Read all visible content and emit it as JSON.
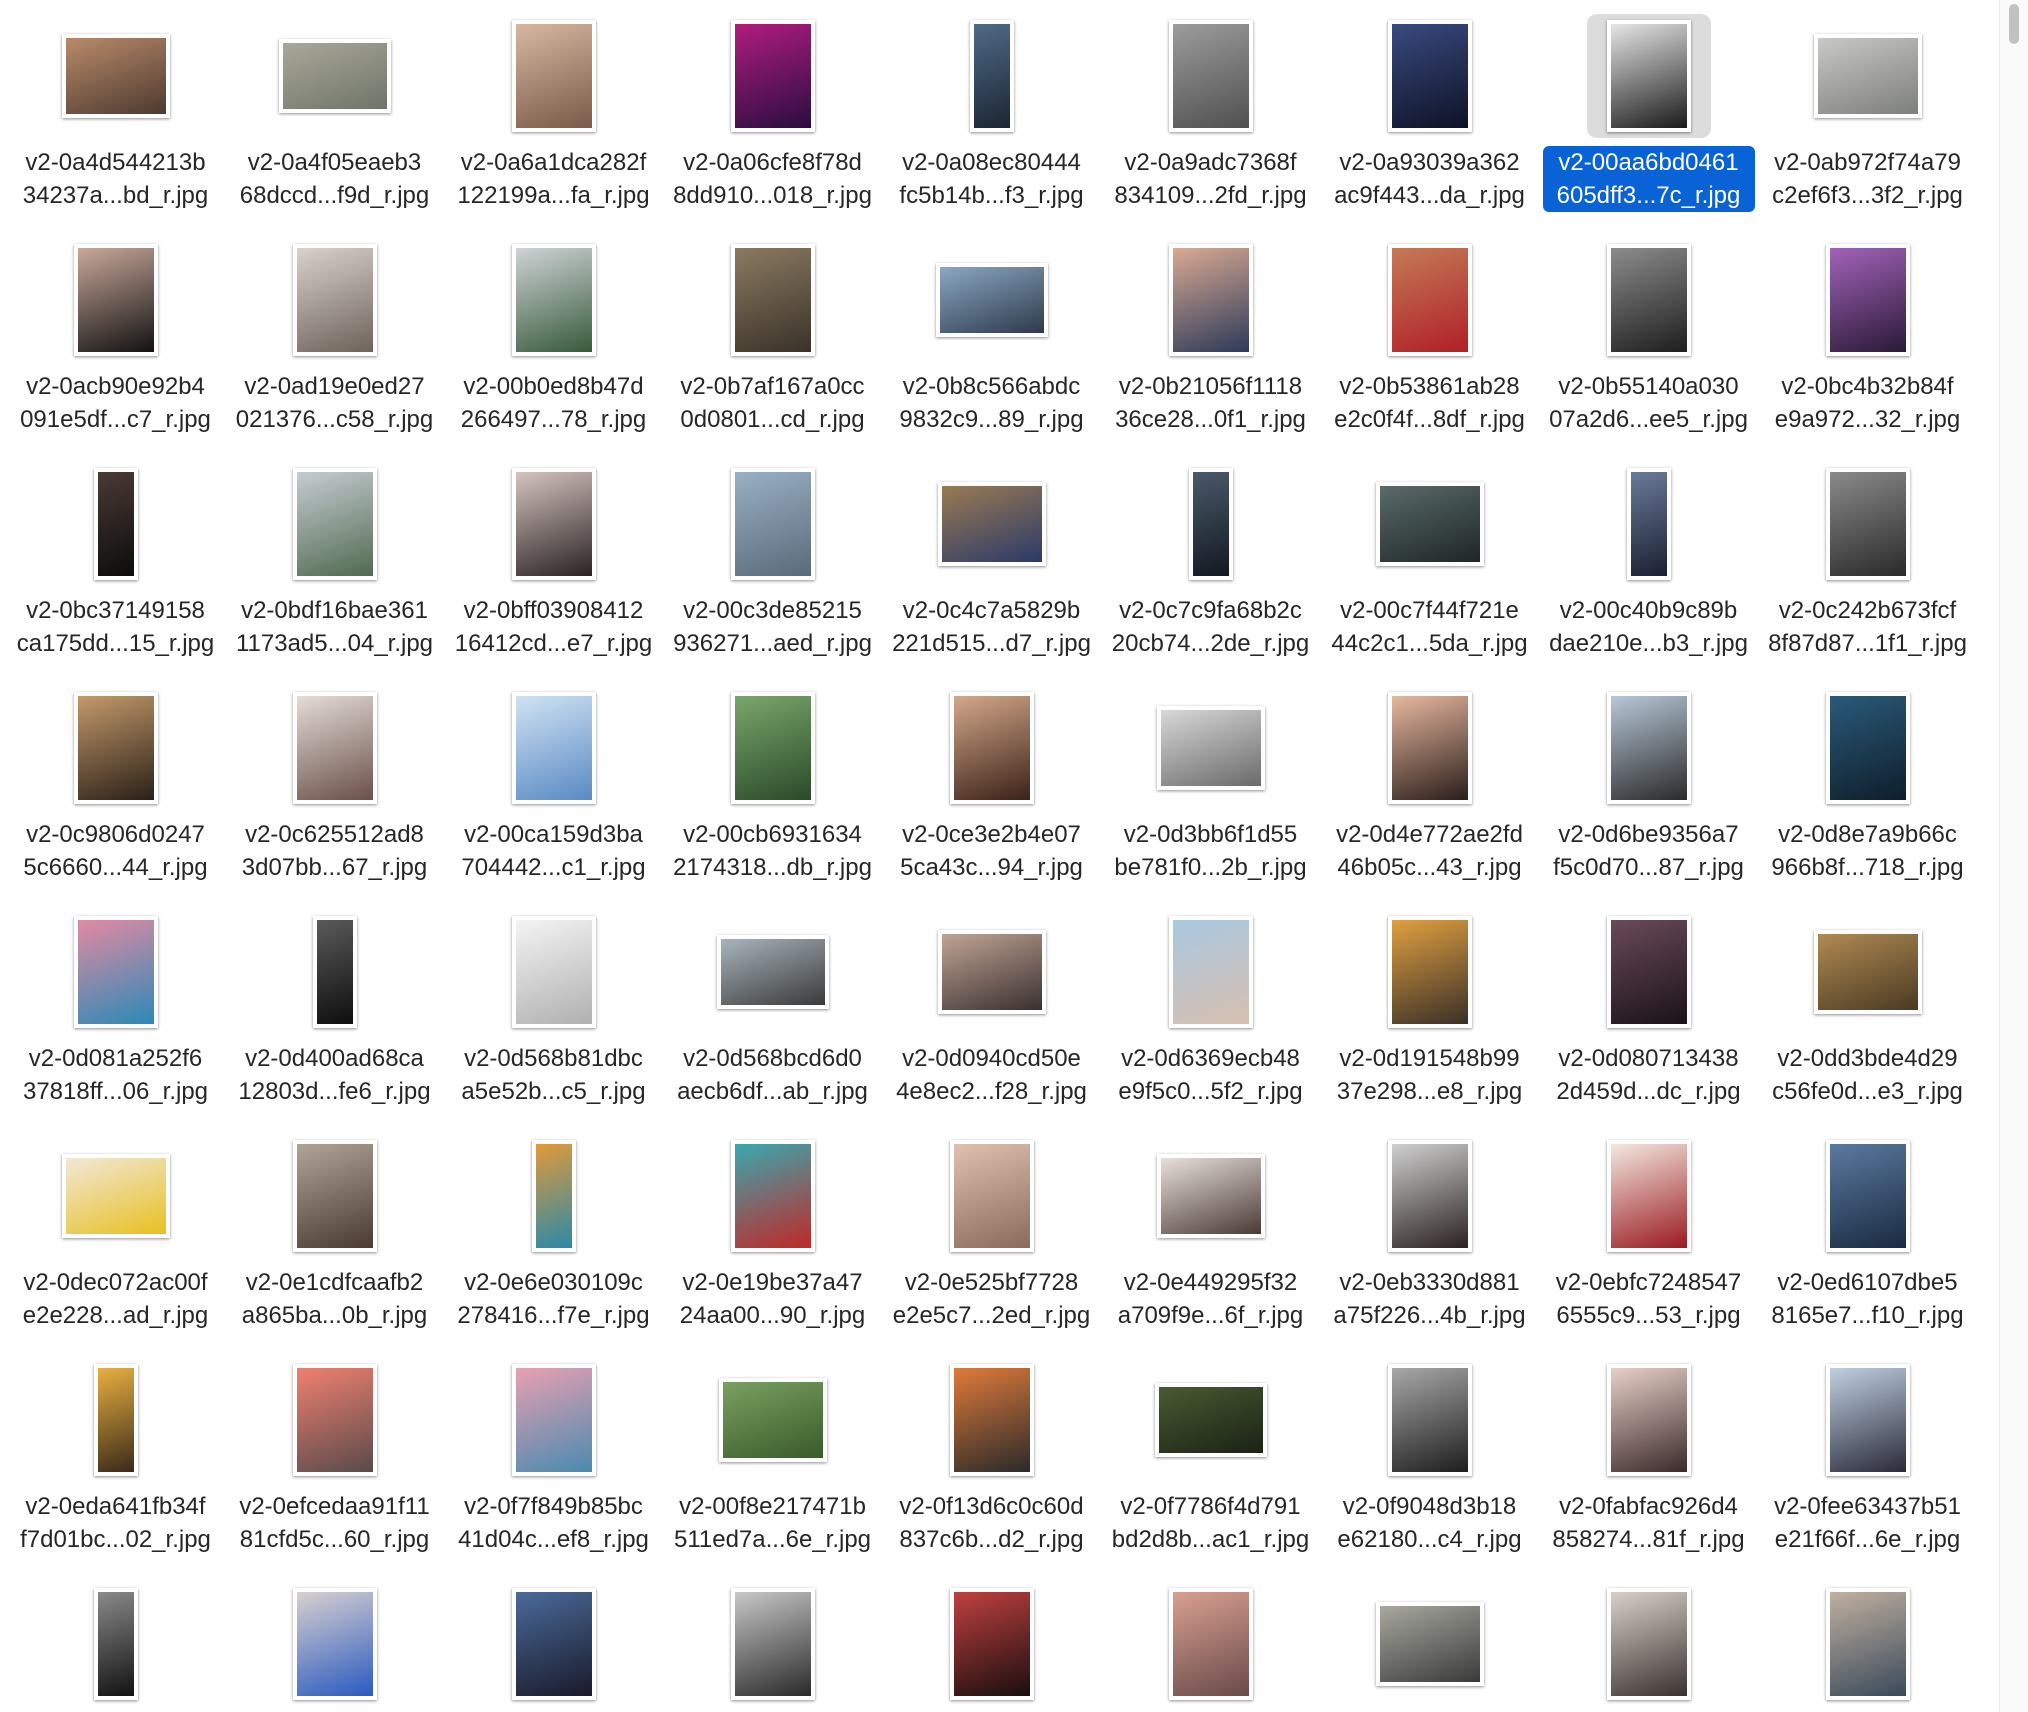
{
  "colors": {
    "selection_fill": "#0a63d6",
    "selection_thumb_bg": "#dcdcdc",
    "label_text": "#262626"
  },
  "files": [
    {
      "line1": "v2-0a4d544213b",
      "line2": "34237a...bd_r.jpg",
      "orientation": "landscape",
      "tone": [
        "#b98a6a",
        "#4d3a30"
      ],
      "selected": false
    },
    {
      "line1": "v2-0a4f05eaeb3",
      "line2": "68dccd...f9d_r.jpg",
      "orientation": "wide",
      "tone": [
        "#a9a89a",
        "#6f7468"
      ],
      "selected": false
    },
    {
      "line1": "v2-0a6a1dca282f",
      "line2": "122199a...fa_r.jpg",
      "orientation": "portrait",
      "tone": [
        "#d6b8a2",
        "#7a5a48"
      ],
      "selected": false
    },
    {
      "line1": "v2-0a06cfe8f78d",
      "line2": "8dd910...018_r.jpg",
      "orientation": "portrait",
      "tone": [
        "#b01c80",
        "#2a0d40"
      ],
      "selected": false
    },
    {
      "line1": "v2-0a08ec80444",
      "line2": "fc5b14b...f3_r.jpg",
      "orientation": "tall",
      "tone": [
        "#4f6a86",
        "#1c2633"
      ],
      "selected": false
    },
    {
      "line1": "v2-0a9adc7368f",
      "line2": "834109...2fd_r.jpg",
      "orientation": "portrait",
      "tone": [
        "#9c9c9c",
        "#505050"
      ],
      "selected": false
    },
    {
      "line1": "v2-0a93039a362",
      "line2": "ac9f443...da_r.jpg",
      "orientation": "portrait",
      "tone": [
        "#3a4a80",
        "#0e1226"
      ],
      "selected": false
    },
    {
      "line1": "v2-00aa6bd0461",
      "line2": "605dff3...7c_r.jpg",
      "orientation": "portrait",
      "tone": [
        "#e6e6e6",
        "#1a1a1a"
      ],
      "selected": true
    },
    {
      "line1": "v2-0ab972f74a79",
      "line2": "c2ef6f3...3f2_r.jpg",
      "orientation": "landscape",
      "tone": [
        "#c8c8c4",
        "#7d7f7a"
      ],
      "selected": false
    },
    {
      "line1": "v2-0acb90e92b4",
      "line2": "091e5df...c7_r.jpg",
      "orientation": "portrait",
      "tone": [
        "#c9a89a",
        "#121212"
      ],
      "selected": false
    },
    {
      "line1": "v2-0ad19e0ed27",
      "line2": "021376...c58_r.jpg",
      "orientation": "portrait",
      "tone": [
        "#d8d2cc",
        "#6e625a"
      ],
      "selected": false
    },
    {
      "line1": "v2-00b0ed8b47d",
      "line2": "266497...78_r.jpg",
      "orientation": "portrait",
      "tone": [
        "#cfd3d6",
        "#375a3a"
      ],
      "selected": false
    },
    {
      "line1": "v2-0b7af167a0cc",
      "line2": "0d0801...cd_r.jpg",
      "orientation": "portrait",
      "tone": [
        "#8a7a62",
        "#3a3228"
      ],
      "selected": false
    },
    {
      "line1": "v2-0b8c566abdc",
      "line2": "9832c9...89_r.jpg",
      "orientation": "wide",
      "tone": [
        "#8aa7c4",
        "#2e3a4a"
      ],
      "selected": false
    },
    {
      "line1": "v2-0b21056f1118",
      "line2": "36ce28...0f1_r.jpg",
      "orientation": "portrait",
      "tone": [
        "#d9aa92",
        "#2c3a5a"
      ],
      "selected": false
    },
    {
      "line1": "v2-0b53861ab28",
      "line2": "e2c0f4f...8df_r.jpg",
      "orientation": "portrait",
      "tone": [
        "#c47a56",
        "#b01f28"
      ],
      "selected": false
    },
    {
      "line1": "v2-0b55140a030",
      "line2": "07a2d6...ee5_r.jpg",
      "orientation": "portrait",
      "tone": [
        "#8c8c8c",
        "#1e1e1e"
      ],
      "selected": false
    },
    {
      "line1": "v2-0bc4b32b84f",
      "line2": "e9a972...32_r.jpg",
      "orientation": "portrait",
      "tone": [
        "#a262b8",
        "#2a1a38"
      ],
      "selected": false
    },
    {
      "line1": "v2-0bc37149158",
      "line2": "ca175dd...15_r.jpg",
      "orientation": "tall",
      "tone": [
        "#4a3a34",
        "#0c0c0c"
      ],
      "selected": false
    },
    {
      "line1": "v2-0bdf16bae361",
      "line2": "1173ad5...04_r.jpg",
      "orientation": "portrait",
      "tone": [
        "#c6ccd2",
        "#506a50"
      ],
      "selected": false
    },
    {
      "line1": "v2-0bff03908412",
      "line2": "16412cd...e7_r.jpg",
      "orientation": "portrait",
      "tone": [
        "#d4c4c0",
        "#2a2222"
      ],
      "selected": false
    },
    {
      "line1": "v2-00c3de85215",
      "line2": "936271...aed_r.jpg",
      "orientation": "portrait",
      "tone": [
        "#9ab0c4",
        "#5a6a7a"
      ],
      "selected": false
    },
    {
      "line1": "v2-0c4c7a5829b",
      "line2": "221d515...d7_r.jpg",
      "orientation": "landscape",
      "tone": [
        "#9a7a52",
        "#2a3a6a"
      ],
      "selected": false
    },
    {
      "line1": "v2-0c7c9fa68b2c",
      "line2": "20cb74...2de_r.jpg",
      "orientation": "tall",
      "tone": [
        "#4a5a6a",
        "#121820"
      ],
      "selected": false
    },
    {
      "line1": "v2-00c7f44f721e",
      "line2": "44c2c1...5da_r.jpg",
      "orientation": "landscape",
      "tone": [
        "#5a6a6a",
        "#1e2626"
      ],
      "selected": false
    },
    {
      "line1": "v2-00c40b9c89b",
      "line2": "dae210e...b3_r.jpg",
      "orientation": "tall",
      "tone": [
        "#6a7a9a",
        "#1a2030"
      ],
      "selected": false
    },
    {
      "line1": "v2-0c242b673fcf",
      "line2": "8f87d87...1f1_r.jpg",
      "orientation": "portrait",
      "tone": [
        "#8a8a8a",
        "#2a2a2a"
      ],
      "selected": false
    },
    {
      "line1": "v2-0c9806d0247",
      "line2": "5c6660...44_r.jpg",
      "orientation": "portrait",
      "tone": [
        "#c49a6a",
        "#2a2018"
      ],
      "selected": false
    },
    {
      "line1": "v2-0c625512ad8",
      "line2": "3d07bb...67_r.jpg",
      "orientation": "portrait",
      "tone": [
        "#e4dcd8",
        "#6a5048"
      ],
      "selected": false
    },
    {
      "line1": "v2-00ca159d3ba",
      "line2": "704442...c1_r.jpg",
      "orientation": "portrait",
      "tone": [
        "#cfe2f3",
        "#5a8ac4"
      ],
      "selected": false
    },
    {
      "line1": "v2-00cb6931634",
      "line2": "2174318...db_r.jpg",
      "orientation": "portrait",
      "tone": [
        "#7aa66a",
        "#2a4a2a"
      ],
      "selected": false
    },
    {
      "line1": "v2-0ce3e2b4e07",
      "line2": "5ca43c...94_r.jpg",
      "orientation": "portrait",
      "tone": [
        "#d4a88a",
        "#3a2218"
      ],
      "selected": false
    },
    {
      "line1": "v2-0d3bb6f1d55",
      "line2": "be781f0...2b_r.jpg",
      "orientation": "landscape",
      "tone": [
        "#d8d8d8",
        "#6a6a6a"
      ],
      "selected": false
    },
    {
      "line1": "v2-0d4e772ae2fd",
      "line2": "46b05c...43_r.jpg",
      "orientation": "portrait",
      "tone": [
        "#e8b8a0",
        "#2a1e1a"
      ],
      "selected": false
    },
    {
      "line1": "v2-0d6be9356a7",
      "line2": "f5c0d70...87_r.jpg",
      "orientation": "portrait",
      "tone": [
        "#b8c8d8",
        "#2a2a2a"
      ],
      "selected": false
    },
    {
      "line1": "v2-0d8e7a9b66c",
      "line2": "966b8f...718_r.jpg",
      "orientation": "portrait",
      "tone": [
        "#2a5a7a",
        "#0e1e2a"
      ],
      "selected": false
    },
    {
      "line1": "v2-0d081a252f6",
      "line2": "37818ff...06_r.jpg",
      "orientation": "portrait",
      "tone": [
        "#e28aa2",
        "#2a8ab8"
      ],
      "selected": false
    },
    {
      "line1": "v2-0d400ad68ca",
      "line2": "12803d...fe6_r.jpg",
      "orientation": "tall",
      "tone": [
        "#5a5a5a",
        "#0e0e0e"
      ],
      "selected": false
    },
    {
      "line1": "v2-0d568b81dbc",
      "line2": "a5e52b...c5_r.jpg",
      "orientation": "portrait",
      "tone": [
        "#f4f4f4",
        "#b0b0b0"
      ],
      "selected": false
    },
    {
      "line1": "v2-0d568bcd6d0",
      "line2": "aecb6df...ab_r.jpg",
      "orientation": "wide",
      "tone": [
        "#a8b4bc",
        "#3a3a3a"
      ],
      "selected": false
    },
    {
      "line1": "v2-0d0940cd50e",
      "line2": "4e8ec2...f28_r.jpg",
      "orientation": "landscape",
      "tone": [
        "#c0a494",
        "#3a3030"
      ],
      "selected": false
    },
    {
      "line1": "v2-0d6369ecb48",
      "line2": "e9f5c0...5f2_r.jpg",
      "orientation": "portrait",
      "tone": [
        "#a8c8e0",
        "#d8c0b0"
      ],
      "selected": false
    },
    {
      "line1": "v2-0d191548b99",
      "line2": "37e298...e8_r.jpg",
      "orientation": "portrait",
      "tone": [
        "#e0a040",
        "#3a3028"
      ],
      "selected": false
    },
    {
      "line1": "v2-0d080713438",
      "line2": "2d459d...dc_r.jpg",
      "orientation": "portrait",
      "tone": [
        "#6a4a5a",
        "#1a1218"
      ],
      "selected": false
    },
    {
      "line1": "v2-0dd3bde4d29",
      "line2": "c56fe0d...e3_r.jpg",
      "orientation": "landscape",
      "tone": [
        "#b08a52",
        "#4a3a22"
      ],
      "selected": false
    },
    {
      "line1": "v2-0dec072ac00f",
      "line2": "e2e228...ad_r.jpg",
      "orientation": "landscape",
      "tone": [
        "#f0e8d8",
        "#e8c020"
      ],
      "selected": false
    },
    {
      "line1": "v2-0e1cdfcaafb2",
      "line2": "a865ba...0b_r.jpg",
      "orientation": "portrait",
      "tone": [
        "#b0a498",
        "#4a3a30"
      ],
      "selected": false
    },
    {
      "line1": "v2-0e6e030109c",
      "line2": "278416...f7e_r.jpg",
      "orientation": "tall",
      "tone": [
        "#e09a3a",
        "#2a8aa8"
      ],
      "selected": false
    },
    {
      "line1": "v2-0e19be37a47",
      "line2": "24aa00...90_r.jpg",
      "orientation": "portrait",
      "tone": [
        "#3aa8b0",
        "#c02828"
      ],
      "selected": false
    },
    {
      "line1": "v2-0e525bf7728",
      "line2": "e2e5c7...2ed_r.jpg",
      "orientation": "portrait",
      "tone": [
        "#e0c0b0",
        "#8a6a5a"
      ],
      "selected": false
    },
    {
      "line1": "v2-0e449295f32",
      "line2": "a709f9e...6f_r.jpg",
      "orientation": "landscape",
      "tone": [
        "#e8e0dc",
        "#4a3a34"
      ],
      "selected": false
    },
    {
      "line1": "v2-0eb3330d881",
      "line2": "a75f226...4b_r.jpg",
      "orientation": "portrait",
      "tone": [
        "#d0d0d0",
        "#2a2220"
      ],
      "selected": false
    },
    {
      "line1": "v2-0ebfc7248547",
      "line2": "6555c9...53_r.jpg",
      "orientation": "portrait",
      "tone": [
        "#f4e8e0",
        "#9a1a20"
      ],
      "selected": false
    },
    {
      "line1": "v2-0ed6107dbe5",
      "line2": "8165e7...f10_r.jpg",
      "orientation": "portrait",
      "tone": [
        "#5a7aa0",
        "#1a2a40"
      ],
      "selected": false
    },
    {
      "line1": "v2-0eda641fb34f",
      "line2": "f7d01bc...02_r.jpg",
      "orientation": "tall",
      "tone": [
        "#e8b040",
        "#3a2a1a"
      ],
      "selected": false
    },
    {
      "line1": "v2-0efcedaa91f11",
      "line2": "81cfd5c...60_r.jpg",
      "orientation": "portrait",
      "tone": [
        "#f08070",
        "#5a4a4a"
      ],
      "selected": false
    },
    {
      "line1": "v2-0f7f849b85bc",
      "line2": "41d04c...ef8_r.jpg",
      "orientation": "portrait",
      "tone": [
        "#e8a0b0",
        "#4a8ab0"
      ],
      "selected": false
    },
    {
      "line1": "v2-00f8e217471b",
      "line2": "511ed7a...6e_r.jpg",
      "orientation": "landscape",
      "tone": [
        "#7aa060",
        "#3a5a2a"
      ],
      "selected": false
    },
    {
      "line1": "v2-0f13d6c0c60d",
      "line2": "837c6b...d2_r.jpg",
      "orientation": "portrait",
      "tone": [
        "#e07a3a",
        "#2a2a2a"
      ],
      "selected": false
    },
    {
      "line1": "v2-0f7786f4d791",
      "line2": "bd2d8b...ac1_r.jpg",
      "orientation": "wide",
      "tone": [
        "#4a5a32",
        "#1a2214"
      ],
      "selected": false
    },
    {
      "line1": "v2-0f9048d3b18",
      "line2": "e62180...c4_r.jpg",
      "orientation": "portrait",
      "tone": [
        "#a8a8a8",
        "#1e1e1e"
      ],
      "selected": false
    },
    {
      "line1": "v2-0fabfac926d4",
      "line2": "858274...81f_r.jpg",
      "orientation": "portrait",
      "tone": [
        "#e8d0c8",
        "#3a2a2a"
      ],
      "selected": false
    },
    {
      "line1": "v2-0fee63437b51",
      "line2": "e21f66f...6e_r.jpg",
      "orientation": "portrait",
      "tone": [
        "#c0d0e0",
        "#2a2a3a"
      ],
      "selected": false
    },
    {
      "line1": "",
      "line2": "",
      "orientation": "tall",
      "tone": [
        "#8a8a8a",
        "#121212"
      ],
      "selected": false
    },
    {
      "line1": "",
      "line2": "",
      "orientation": "portrait",
      "tone": [
        "#d8d0d0",
        "#2a5ac0"
      ],
      "selected": false
    },
    {
      "line1": "",
      "line2": "",
      "orientation": "portrait",
      "tone": [
        "#4a6a9a",
        "#1a1a2a"
      ],
      "selected": false
    },
    {
      "line1": "",
      "line2": "",
      "orientation": "portrait",
      "tone": [
        "#c8c8c8",
        "#2a2a2a"
      ],
      "selected": false
    },
    {
      "line1": "",
      "line2": "",
      "orientation": "portrait",
      "tone": [
        "#c04040",
        "#1a0e0e"
      ],
      "selected": false
    },
    {
      "line1": "",
      "line2": "",
      "orientation": "portrait",
      "tone": [
        "#d8a090",
        "#6a4a4a"
      ],
      "selected": false
    },
    {
      "line1": "",
      "line2": "",
      "orientation": "landscape",
      "tone": [
        "#a8a8a0",
        "#3a3a3a"
      ],
      "selected": false
    },
    {
      "line1": "",
      "line2": "",
      "orientation": "portrait",
      "tone": [
        "#d8d0c8",
        "#3a3230"
      ],
      "selected": false
    },
    {
      "line1": "",
      "line2": "",
      "orientation": "portrait",
      "tone": [
        "#c0b0a0",
        "#3a4a5a"
      ],
      "selected": false
    }
  ]
}
